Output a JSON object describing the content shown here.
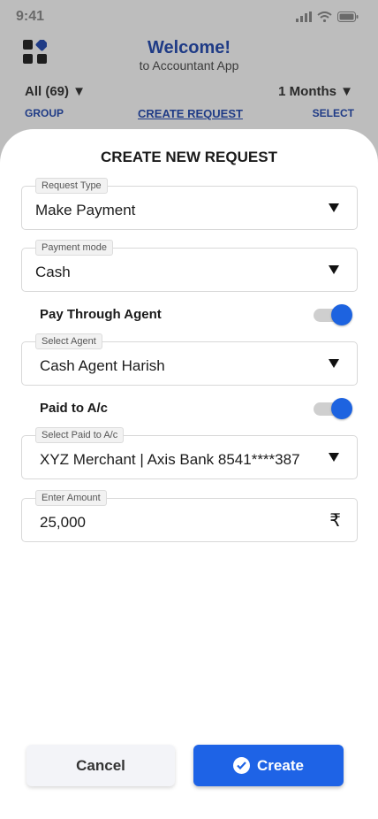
{
  "status_bar": {
    "time": "9:41"
  },
  "header": {
    "welcome": "Welcome!",
    "subtitle": "to Accountant App",
    "filter_left": "All (69) ▼",
    "filter_right": "1 Months ▼",
    "nav": {
      "group": "GROUP",
      "create_request": "CREATE REQUEST",
      "select": "SELECT"
    }
  },
  "sheet": {
    "title": "CREATE NEW REQUEST",
    "request_type": {
      "label": "Request Type",
      "value": "Make Payment"
    },
    "payment_mode": {
      "label": "Payment mode",
      "value": "Cash"
    },
    "pay_through_agent": {
      "label": "Pay Through Agent",
      "enabled": true
    },
    "select_agent": {
      "label": "Select Agent",
      "value": "Cash Agent Harish"
    },
    "paid_to_ac": {
      "label": "Paid to A/c",
      "enabled": true
    },
    "select_paid_to": {
      "label": "Select Paid to A/c",
      "value": "XYZ Merchant | Axis Bank 8541****387"
    },
    "amount": {
      "label": "Enter Amount",
      "value": "25,000",
      "currency_symbol": "₹"
    },
    "cancel_label": "Cancel",
    "create_label": "Create"
  },
  "colors": {
    "accent": "#1e63e6",
    "title_blue": "#1f3b86"
  }
}
